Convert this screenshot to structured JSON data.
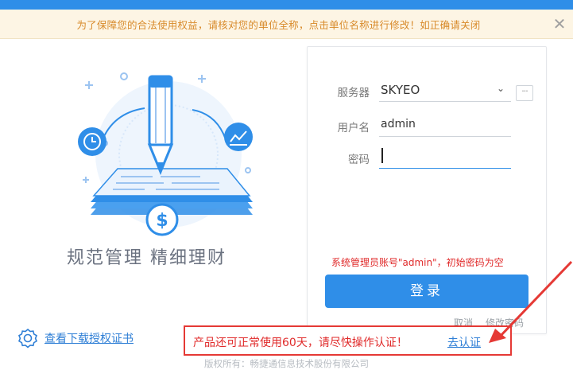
{
  "notice": {
    "text": "为了保障您的合法使用权益，请核对您的单位全称，点击单位名称进行修改！如正确请关闭",
    "close": "✕"
  },
  "hero": {
    "slogan": "规范管理  精细理财"
  },
  "login": {
    "server_label": "服务器",
    "server_value": "SKYEO",
    "more_label": "···",
    "user_label": "用户名",
    "user_value": "admin",
    "password_label": "密码",
    "password_value": "",
    "hint": "系统管理员账号\"admin\"，初始密码为空",
    "login_button": "登录",
    "cancel": "取消",
    "change_password": "修改密码"
  },
  "footer": {
    "cert_link": "查看下载授权证书",
    "alert_text": "产品还可正常使用60天，请尽快操作认证！",
    "alert_link": "去认证",
    "copyright": "版权所有：畅捷通信息技术股份有限公司"
  },
  "colors": {
    "primary": "#2f8ee8",
    "notice_bg": "#fdf5e4",
    "notice_text": "#d88a2a",
    "alert_red": "#e53935"
  },
  "icons": [
    "close-icon",
    "pencil-icon",
    "clock-icon",
    "chart-icon",
    "dollar-icon",
    "chevron-down-icon",
    "certificate-icon",
    "arrow-icon"
  ]
}
